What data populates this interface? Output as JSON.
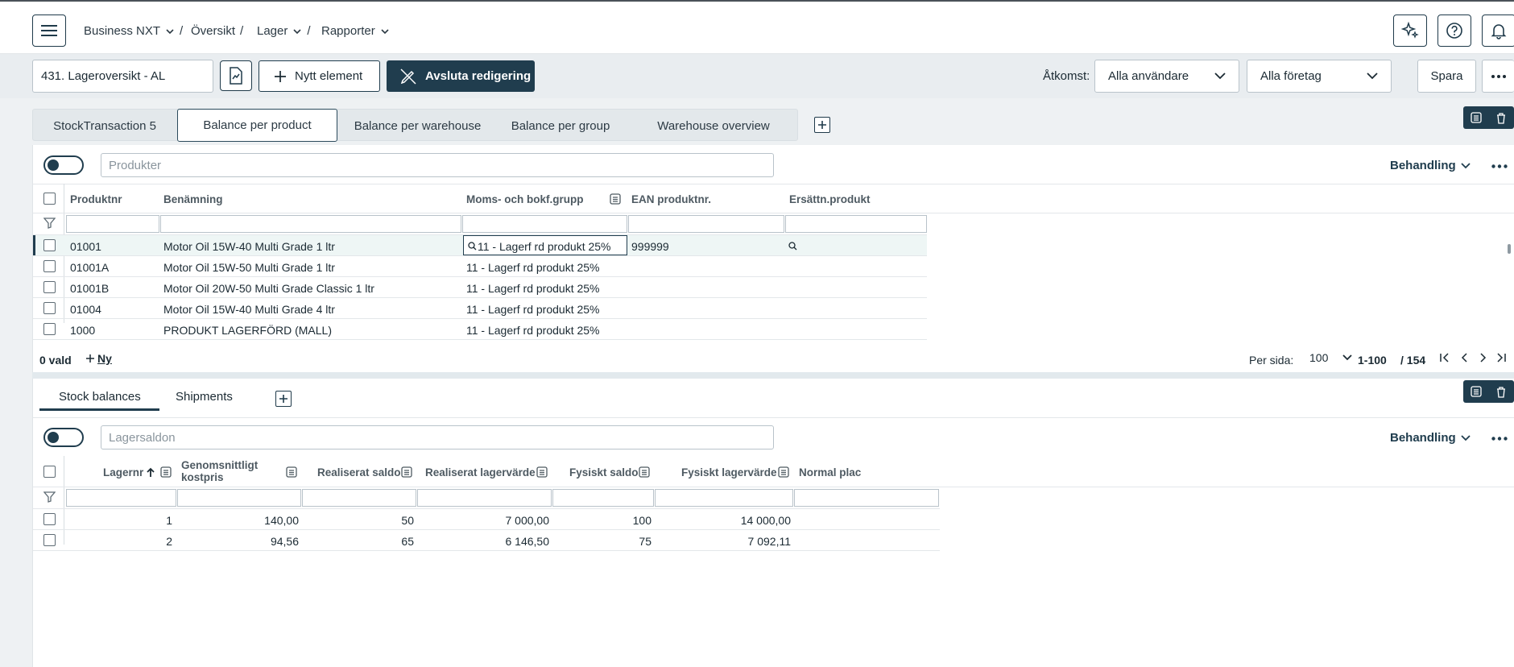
{
  "header": {
    "breadcrumbs": [
      "Business NXT",
      "Översikt",
      "Lager",
      "Rapporter"
    ]
  },
  "toolbar": {
    "report_name": "431. Lageroversikt - AL",
    "new_element": "Nytt element",
    "end_edit": "Avsluta redigering",
    "access_label": "Åtkomst:",
    "users_value": "Alla användare",
    "companies_value": "Alla företag",
    "save": "Spara"
  },
  "tabs": [
    "StockTransaction 5",
    "Balance per product",
    "Balance per warehouse",
    "Balance per group",
    "Warehouse overview"
  ],
  "products": {
    "search_placeholder": "Produkter",
    "behandling": "Behandling",
    "columns": [
      "Produktnr",
      "Benämning",
      "Moms- och bokf.grupp",
      "EAN produktnr.",
      "Ersättn.produkt"
    ],
    "rows": [
      {
        "nr": "01001",
        "name": "Motor Oil 15W-40 Multi Grade 1 ltr",
        "group": "11 - Lagerf rd produkt 25%",
        "ean": "999999"
      },
      {
        "nr": "01001A",
        "name": "Motor Oil 15W-50 Multi Grade 1 ltr",
        "group": "11 - Lagerf rd produkt 25%",
        "ean": ""
      },
      {
        "nr": "01001B",
        "name": "Motor Oil 20W-50 Multi Grade Classic 1 ltr",
        "group": "11 - Lagerf rd produkt 25%",
        "ean": ""
      },
      {
        "nr": "01004",
        "name": "Motor Oil 15W-40 Multi Grade 4 ltr",
        "group": "11 - Lagerf rd produkt 25%",
        "ean": ""
      },
      {
        "nr": "1000",
        "name": "PRODUKT LAGERFÖRD (MALL)",
        "group": "11 - Lagerf rd produkt 25%",
        "ean": ""
      }
    ],
    "selected": "0 vald",
    "new": "Ny",
    "per_page_label": "Per sida:",
    "per_page": "100",
    "range": "1-100",
    "total": "/ 154"
  },
  "lower_tabs": [
    "Stock balances",
    "Shipments"
  ],
  "balances": {
    "search_placeholder": "Lagersaldon",
    "behandling": "Behandling",
    "columns": [
      "Lagernr",
      "Genomsnittligt kostpris",
      "Realiserat saldo",
      "Realiserat lagervärde",
      "Fysiskt saldo",
      "Fysiskt lagervärde",
      "Normal plac"
    ],
    "rows": [
      {
        "lager": "1",
        "kost": "140,00",
        "rsaldo": "50",
        "rvarde": "7 000,00",
        "fsaldo": "100",
        "fvarde": "14 000,00"
      },
      {
        "lager": "2",
        "kost": "94,56",
        "rsaldo": "65",
        "rvarde": "6 146,50",
        "fsaldo": "75",
        "fvarde": "7 092,11"
      }
    ]
  }
}
